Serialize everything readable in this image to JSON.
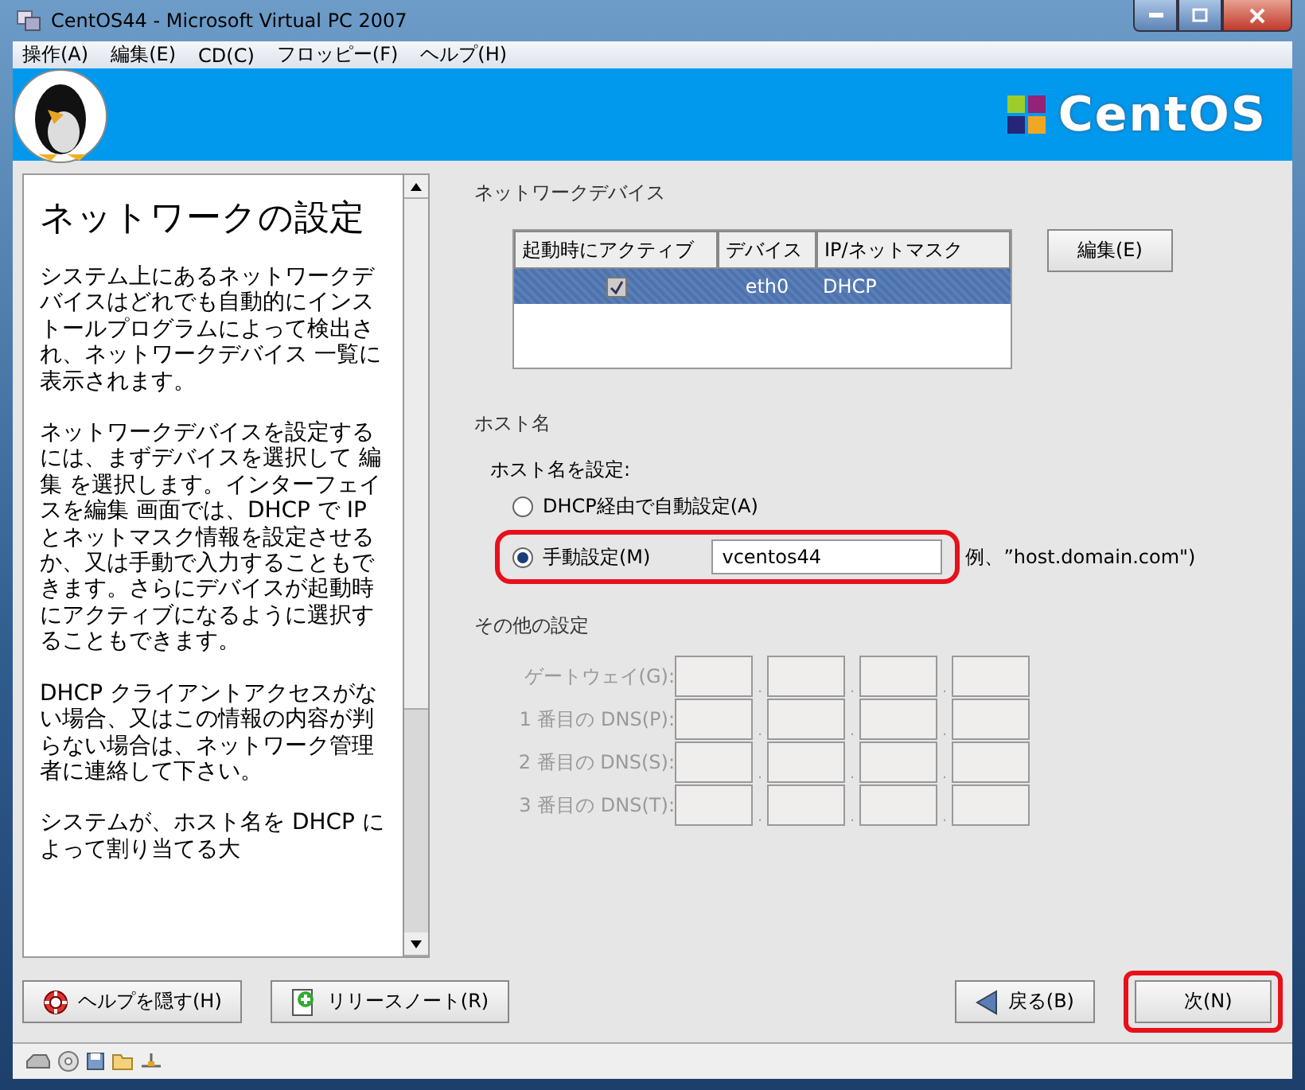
{
  "window": {
    "title": "CentOS44 - Microsoft Virtual PC 2007"
  },
  "menu": [
    "操作(A)",
    "編集(E)",
    "CD(C)",
    "フロッピー(F)",
    "ヘルプ(H)"
  ],
  "banner": {
    "logo_text": "CentOS"
  },
  "help": {
    "title": "ネットワークの設定",
    "paragraphs": [
      "システム上にあるネットワークデバイスはどれでも自動的にインストールプログラムによって検出され、ネットワークデバイス 一覧に表示されます。",
      "ネットワークデバイスを設定するには、まずデバイスを選択して 編集 を選択します。インターフェイスを編集 画面では、DHCP で IP とネットマスク情報を設定させるか、又は手動で入力することもできます。さらにデバイスが起動時にアクティブになるように選択することもできます。",
      "DHCP クライアントアクセスがない場合、又はこの情報の内容が判らない場合は、ネットワーク管理者に連絡して下さい。",
      "システムが、ホスト名を DHCP によって割り当てる大"
    ]
  },
  "network_devices": {
    "heading": "ネットワークデバイス",
    "columns": [
      "起動時にアクティブ",
      "デバイス",
      "IP/ネットマスク"
    ],
    "rows": [
      {
        "active": true,
        "device": "eth0",
        "ip": "DHCP",
        "selected": true
      }
    ],
    "edit_button": "編集(E)"
  },
  "hostname": {
    "heading": "ホスト名",
    "label": "ホスト名を設定:",
    "options": [
      {
        "label": "DHCP経由で自動設定(A)",
        "selected": false,
        "highlighted": false
      },
      {
        "label": "手動設定(M)",
        "selected": true,
        "highlighted": true
      }
    ],
    "value": "vcentos44",
    "example": "例、”host.domain.com\")"
  },
  "other": {
    "heading": "その他の設定",
    "disabled": true,
    "separator": ".",
    "rows": [
      {
        "label": "ゲートウェイ(G):"
      },
      {
        "label": "1 番目の DNS(P):"
      },
      {
        "label": "2 番目の DNS(S):"
      },
      {
        "label": "3 番目の DNS(T):"
      }
    ]
  },
  "buttons": {
    "left": [
      {
        "kind": "help",
        "label": "ヘルプを隠す(H)",
        "highlighted": false
      },
      {
        "kind": "notes",
        "label": "リリースノート(R)",
        "highlighted": false
      }
    ],
    "right": [
      {
        "kind": "back",
        "label": "戻る(B)",
        "highlighted": false
      },
      {
        "kind": "next",
        "label": "次(N)",
        "highlighted": true
      }
    ]
  }
}
